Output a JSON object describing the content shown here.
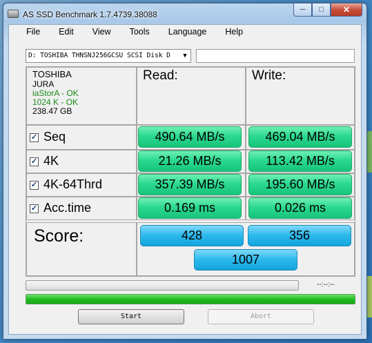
{
  "window": {
    "title": "AS SSD Benchmark 1.7.4739.38088"
  },
  "menu": [
    "File",
    "Edit",
    "View",
    "Tools",
    "Language",
    "Help"
  ],
  "drive": {
    "selected": "D: TOSHIBA THNSNJ256GCSU SCSI Disk D",
    "path": ""
  },
  "info": {
    "model": "TOSHIBA",
    "firmware": "JURA",
    "driver": "iaStorA - OK",
    "alignment": "1024 K - OK",
    "size": "238.47 GB"
  },
  "headers": {
    "read": "Read:",
    "write": "Write:"
  },
  "rows": [
    {
      "label": "Seq",
      "checked": true,
      "read": "490.64 MB/s",
      "write": "469.04 MB/s"
    },
    {
      "label": "4K",
      "checked": true,
      "read": "21.26 MB/s",
      "write": "113.42 MB/s"
    },
    {
      "label": "4K-64Thrd",
      "checked": true,
      "read": "357.39 MB/s",
      "write": "195.60 MB/s"
    },
    {
      "label": "Acc.time",
      "checked": true,
      "read": "0.169 ms",
      "write": "0.026 ms"
    }
  ],
  "score": {
    "label": "Score:",
    "read": "428",
    "write": "356",
    "total": "1007"
  },
  "progress": {
    "elapsed": "--:--:--",
    "test_progress": 0,
    "total_progress": 1
  },
  "buttons": {
    "start": "Start",
    "abort": "Abort"
  },
  "colors": {
    "result_green": "#2cd98f",
    "score_blue": "#2bb8ec",
    "progress_green": "#21bb21"
  }
}
